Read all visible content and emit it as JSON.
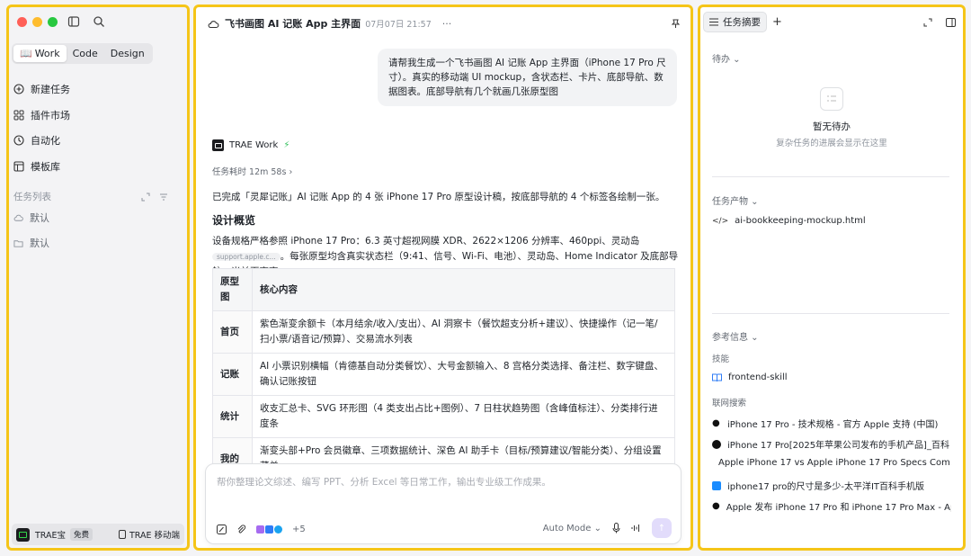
{
  "sidebar": {
    "modes": [
      "Work",
      "Code",
      "Design"
    ],
    "nav": [
      {
        "label": "新建任务",
        "icon": "plus-circle-icon"
      },
      {
        "label": "插件市场",
        "icon": "plugin-icon"
      },
      {
        "label": "自动化",
        "icon": "clock-icon"
      },
      {
        "label": "模板库",
        "icon": "template-icon"
      }
    ],
    "task_list_label": "任务列表",
    "tasks": [
      {
        "label": "默认",
        "icon": "cloud-icon"
      },
      {
        "label": "默认",
        "icon": "folder-icon"
      }
    ],
    "bottom": {
      "account": "TRAE宝",
      "plan": "免费",
      "mobile": "TRAE 移动端"
    }
  },
  "chat": {
    "title": "飞书画图 AI 记账 App 主界面",
    "date": "07月07日 21:57",
    "more": "···",
    "user_message": "请帮我生成一个飞书画图 AI 记账 App 主界面（iPhone 17 Pro 尺寸）。真实的移动端 UI mockup，含状态栏、卡片、底部导航、数据图表。底部导航有几个就画几张原型图",
    "agent_name": "TRAE Work",
    "elapsed": "任务耗时 12m 58s",
    "summary": "已完成「灵犀记账」AI 记账 App 的 4 张 iPhone 17 Pro 原型设计稿，按底部导航的 4 个标签各绘制一张。",
    "heading": "设计概览",
    "spec_text": "设备规格严格参照 iPhone 17 Pro：6.3 英寸超视网膜 XDR、2622×1206 分辨率、460ppi、灵动岛",
    "source_chip": "support.apple.c...",
    "spec_text2": "。每张原型均含真实状态栏（9:41、信号、Wi-Fi、电池）、灵动岛、Home Indicator 及底部导航，当前页高亮。",
    "table": {
      "headers": [
        "原型图",
        "核心内容"
      ],
      "rows": [
        {
          "name": "首页",
          "content": "紫色渐变余额卡（本月结余/收入/支出）、AI 洞察卡（餐饮超支分析+建议）、快捷操作（记一笔/扫小票/语音记/预算）、交易流水列表"
        },
        {
          "name": "记账",
          "content": "AI 小票识别横幅（肯德基自动分类餐饮）、大号金额输入、8 宫格分类选择、备注栏、数字键盘、确认记账按钮"
        },
        {
          "name": "统计",
          "content": "收支汇总卡、SVG 环形图（4 类支出占比+图例）、7 日柱状趋势图（含峰值标注）、分类排行进度条"
        },
        {
          "name": "我的",
          "content": "渐变头部+Pro 会员徽章、三项数据统计、深色 AI 助手卡（目标/预算建议/智能分类）、分组设置菜单"
        }
      ]
    },
    "composer": {
      "placeholder": "帮你整理论文综述、编写 PPT、分析 Excel 等日常工作，输出专业级工作成果。",
      "more_count": "+5",
      "mode": "Auto Mode"
    }
  },
  "panel": {
    "tab": "任务摘要",
    "todo_label": "待办",
    "empty_title": "暂无待办",
    "empty_sub": "复杂任务的进展会显示在这里",
    "artifacts_label": "任务产物",
    "artifact": "ai-bookkeeping-mockup.html",
    "refs_label": "参考信息",
    "skills_label": "技能",
    "skill": "frontend-skill",
    "web_label": "联网搜索",
    "web_results": [
      {
        "title": "iPhone 17 Pro - 技术规格 - 官方 Apple 支持 (中国)",
        "icon": "apple-icon"
      },
      {
        "title": "iPhone 17 Pro[2025年苹果公司发布的手机产品]_百科",
        "icon": "baike-icon"
      },
      {
        "title": "Apple iPhone 17 vs Apple iPhone 17 Pro Specs Com...",
        "icon": "gsmarena-icon"
      },
      {
        "title": "iphone17 pro的尺寸是多少-太平洋IT百科手机版",
        "icon": "pconline-icon"
      },
      {
        "title": "Apple 发布 iPhone 17 Pro 和 iPhone 17 Pro Max - Ap...",
        "icon": "apple-icon"
      }
    ]
  },
  "colors": {
    "highlight_border": "#f5c518",
    "accent": "#7b61ff",
    "traffic": [
      "#ff5f57",
      "#febc2e",
      "#28c840"
    ]
  }
}
